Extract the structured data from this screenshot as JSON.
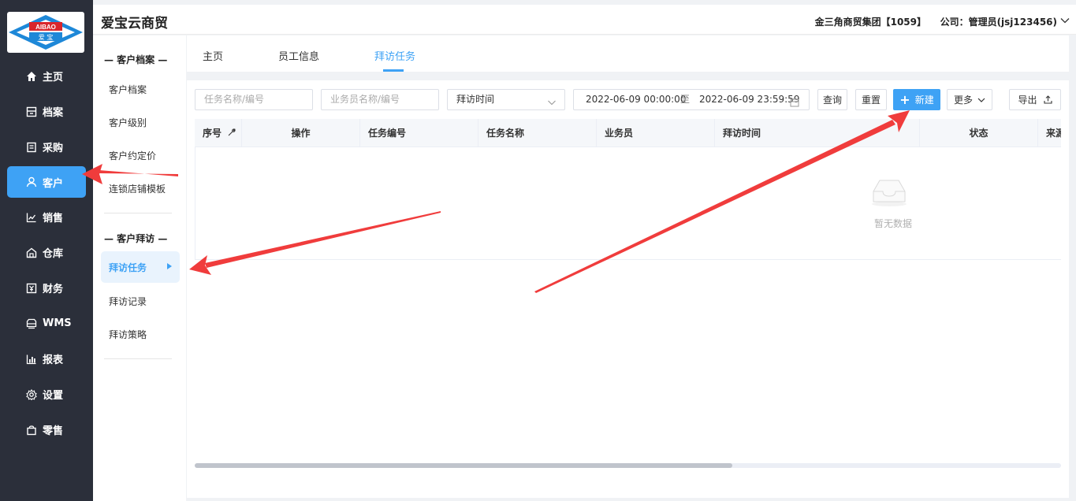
{
  "app": {
    "title": "爱宝云商贸",
    "logo_text_top": "AIBAO",
    "logo_text_bottom": "爱 宝"
  },
  "header": {
    "company": "金三角商贸集团【1059】",
    "user": "公司：管理员(jsj123456)"
  },
  "sidebar": {
    "items": [
      {
        "label": "主页",
        "icon": "home-icon"
      },
      {
        "label": "档案",
        "icon": "archive-icon"
      },
      {
        "label": "采购",
        "icon": "purchase-icon"
      },
      {
        "label": "客户",
        "icon": "user-icon",
        "active": true
      },
      {
        "label": "销售",
        "icon": "chart-line-icon"
      },
      {
        "label": "仓库",
        "icon": "warehouse-icon"
      },
      {
        "label": "财务",
        "icon": "finance-icon"
      },
      {
        "label": "WMS",
        "icon": "truck-icon"
      },
      {
        "label": "报表",
        "icon": "bar-chart-icon"
      },
      {
        "label": "设置",
        "icon": "gear-icon"
      },
      {
        "label": "零售",
        "icon": "bag-icon"
      }
    ]
  },
  "submenu": {
    "group1": "— 客户档案 —",
    "group1_items": [
      "客户档案",
      "客户级别",
      "客户约定价",
      "连锁店铺模板"
    ],
    "group2": "— 客户拜访 —",
    "group2_items": [
      "拜访任务",
      "拜访记录",
      "拜访策略"
    ]
  },
  "tabs": [
    "主页",
    "员工信息",
    "拜访任务"
  ],
  "filters": {
    "task_placeholder": "任务名称/编号",
    "staff_placeholder": "业务员名称/编号",
    "time_select": "拜访时间",
    "date_start": "2022-06-09 00:00:00",
    "date_sep": "至",
    "date_end": "2022-06-09 23:59:59"
  },
  "buttons": {
    "query": "查询",
    "reset": "重置",
    "new": "新建",
    "more": "更多",
    "export": "导出"
  },
  "table": {
    "columns": [
      "序号",
      "操作",
      "任务编号",
      "任务名称",
      "业务员",
      "拜访时间",
      "状态",
      "来源"
    ],
    "empty_text": "暂无数据"
  },
  "colors": {
    "sidebar_bg": "#2b2f3a",
    "accent": "#3ea2f5",
    "annotation_arrow": "#f03c3c"
  }
}
